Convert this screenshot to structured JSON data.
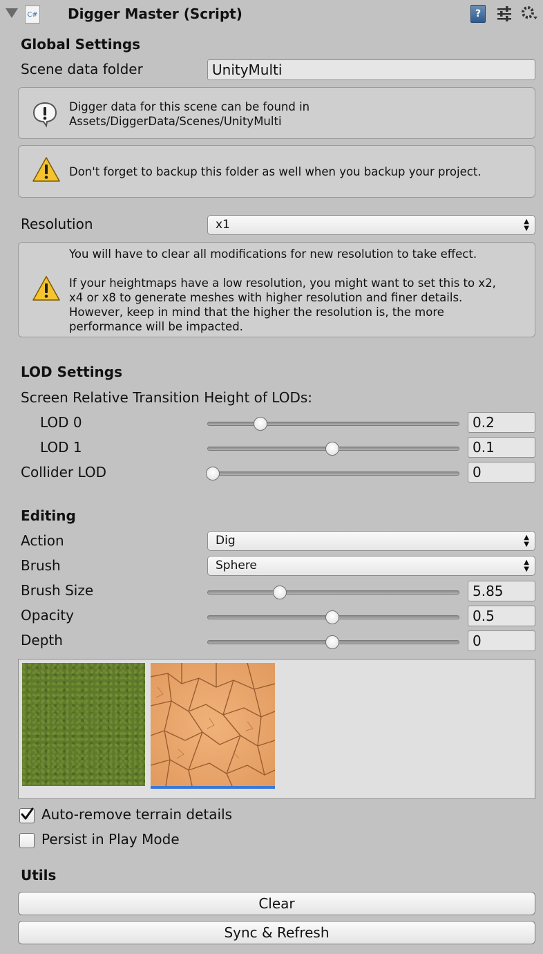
{
  "header": {
    "title": "Digger Master (Script)",
    "script_badge": "C#",
    "fold_icon": "triangle-down-icon",
    "help_icon": "book-help-icon",
    "preset_icon": "sliders-preset-icon",
    "settings_icon": "gear-icon"
  },
  "global": {
    "title": "Global Settings",
    "scene_folder_label": "Scene data folder",
    "scene_folder_value": "UnityMulti",
    "info_line1": "Digger data for this scene can be found in",
    "info_line2": "Assets/DiggerData/Scenes/UnityMulti",
    "warning_backup": "Don't forget to backup this folder as well when you backup your project.",
    "resolution_label": "Resolution",
    "resolution_value": "x1",
    "res_warn_line1": "You will have to clear all modifications for new resolution to take effect.",
    "res_warn_line2": "If your heightmaps have a low resolution, you might want to set this to x2,",
    "res_warn_line3": "x4 or x8 to generate meshes with higher resolution and finer details.",
    "res_warn_line4": "However, keep in mind that the higher the resolution is, the more",
    "res_warn_line5": "performance will be impacted."
  },
  "lod": {
    "title": "LOD Settings",
    "subtitle": "Screen Relative Transition Height of LODs:",
    "lod0_label": "LOD 0",
    "lod0_value": "0.2",
    "lod0_level": 0.2,
    "lod1_label": "LOD 1",
    "lod1_value": "0.1",
    "lod1_level": 0.5,
    "collider_label": "Collider LOD",
    "collider_value": "0",
    "collider_level": 0.0
  },
  "editing": {
    "title": "Editing",
    "action_label": "Action",
    "action_value": "Dig",
    "brush_label": "Brush",
    "brush_value": "Sphere",
    "brush_size_label": "Brush Size",
    "brush_size_value": "5.85",
    "brush_size_level": 0.28,
    "opacity_label": "Opacity",
    "opacity_value": "0.5",
    "opacity_level": 0.5,
    "depth_label": "Depth",
    "depth_value": "0",
    "depth_level": 0.5,
    "textures": [
      "grass-texture",
      "cracked-dirt-texture"
    ],
    "selected_texture": 1,
    "auto_remove_label": "Auto-remove terrain details",
    "auto_remove_checked": true,
    "persist_label": "Persist in Play Mode",
    "persist_checked": false
  },
  "utils": {
    "title": "Utils",
    "clear_label": "Clear",
    "sync_label": "Sync & Refresh"
  },
  "colors": {
    "background": "#c2c2c2",
    "selection_underline": "#3a78d8",
    "warning_yellow": "#f4c430"
  }
}
